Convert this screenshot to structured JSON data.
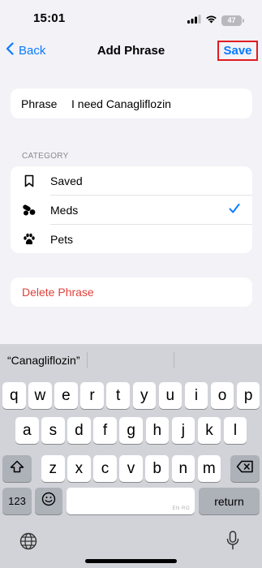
{
  "status": {
    "time": "15:01",
    "battery": "47"
  },
  "nav": {
    "back_label": "Back",
    "title": "Add Phrase",
    "save_label": "Save"
  },
  "phrase": {
    "label": "Phrase",
    "value": "I need Canagliflozin"
  },
  "category": {
    "header": "CATEGORY",
    "items": [
      {
        "label": "Saved",
        "icon": "bookmark-icon",
        "selected": false
      },
      {
        "label": "Meds",
        "icon": "pills-icon",
        "selected": true
      },
      {
        "label": "Pets",
        "icon": "paw-icon",
        "selected": false
      }
    ]
  },
  "delete_label": "Delete Phrase",
  "keyboard": {
    "suggestion": "“Canagliflozin”",
    "row1": [
      "q",
      "w",
      "e",
      "r",
      "t",
      "y",
      "u",
      "i",
      "o",
      "p"
    ],
    "row2": [
      "a",
      "s",
      "d",
      "f",
      "g",
      "h",
      "j",
      "k",
      "l"
    ],
    "row3": [
      "z",
      "x",
      "c",
      "v",
      "b",
      "n",
      "m"
    ],
    "numbers_label": "123",
    "return_label": "return",
    "space_note": "EN RO"
  },
  "colors": {
    "accent": "#0a7aff",
    "destructive": "#e0413a",
    "highlight_border": "#e11b22"
  }
}
